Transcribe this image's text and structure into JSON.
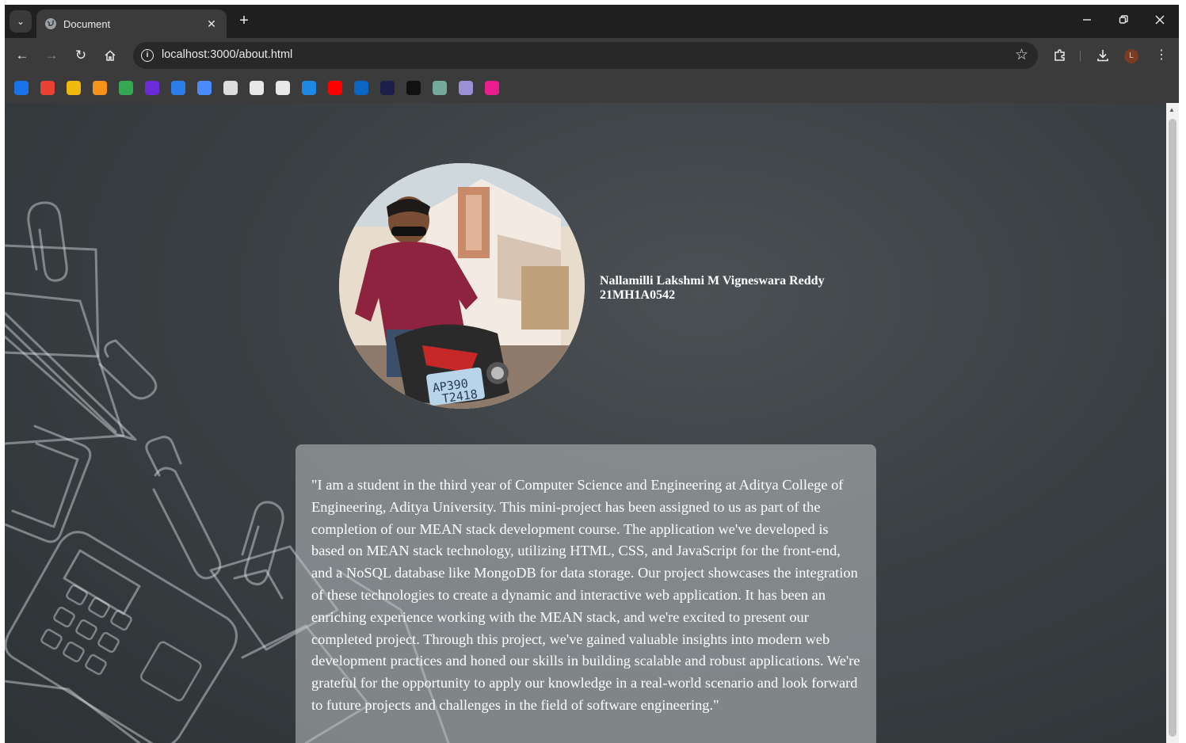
{
  "browser": {
    "tab_title": "Document",
    "tab_close": "✕",
    "new_tab": "+",
    "minimize": "—",
    "restore": "❐",
    "close": "✕",
    "url": "localhost:3000/about.html",
    "profile_initial": "L",
    "bookmarks": [
      {
        "icon": "blue-diamond-icon",
        "color": "#1a73e8"
      },
      {
        "icon": "arrow-icon",
        "color": "#e94235"
      },
      {
        "icon": "cc-icon",
        "color": "#f0b90b"
      },
      {
        "icon": "coin-icon",
        "color": "#f7931a"
      },
      {
        "icon": "leaf-icon",
        "color": "#34a853"
      },
      {
        "icon": "m-logo-icon",
        "color": "#6c2bd9"
      },
      {
        "icon": "s-logo-icon",
        "color": "#2b7de9"
      },
      {
        "icon": "gemini-icon",
        "color": "#4a8cff"
      },
      {
        "icon": "doc-icon",
        "color": "#dddddd"
      },
      {
        "icon": "book-icon",
        "color": "#e8e8e8"
      },
      {
        "icon": "globe-icon",
        "color": "#e8e8e8"
      },
      {
        "icon": "download-box-icon",
        "color": "#1e88e5"
      },
      {
        "icon": "youtube-icon",
        "color": "#ff0000"
      },
      {
        "icon": "linkedin-icon",
        "color": "#0a66c2"
      },
      {
        "icon": "dn-icon",
        "color": "#1b1f4a"
      },
      {
        "icon": "me-icon",
        "color": "#111111"
      },
      {
        "icon": "chatgpt-icon",
        "color": "#74aa9c"
      },
      {
        "icon": "figure-icon",
        "color": "#9c8fd6"
      },
      {
        "icon": "pink-box-icon",
        "color": "#e91e8c"
      }
    ]
  },
  "profile": {
    "name": "Nallamilli Lakshmi M Vigneswara Reddy",
    "roll_number": "21MH1A0542"
  },
  "about": {
    "text": "\"I am a student in the third year of Computer Science and Engineering at Aditya College of Engineering, Aditya University. This mini-project has been assigned to us as part of the completion of our MEAN stack development course. The application we've developed is based on MEAN stack technology, utilizing HTML, CSS, and JavaScript for the front-end, and a NoSQL database like MongoDB for data storage. Our project showcases the integration of these technologies to create a dynamic and interactive web application. It has been an enriching experience working with the MEAN stack, and we're excited to present our completed project. Through this project, we've gained valuable insights into modern web development practices and honed our skills in building scalable and robust applications. We're grateful for the opportunity to apply our knowledge in a real-world scenario and look forward to future projects and challenges in the field of software engineering.\""
  },
  "colors": {
    "chrome_dark": "#1f1f1f",
    "toolbar": "#3b3b3b",
    "card_bg": "rgba(190,194,196,0.55)",
    "page_bg": "#3a4043"
  }
}
